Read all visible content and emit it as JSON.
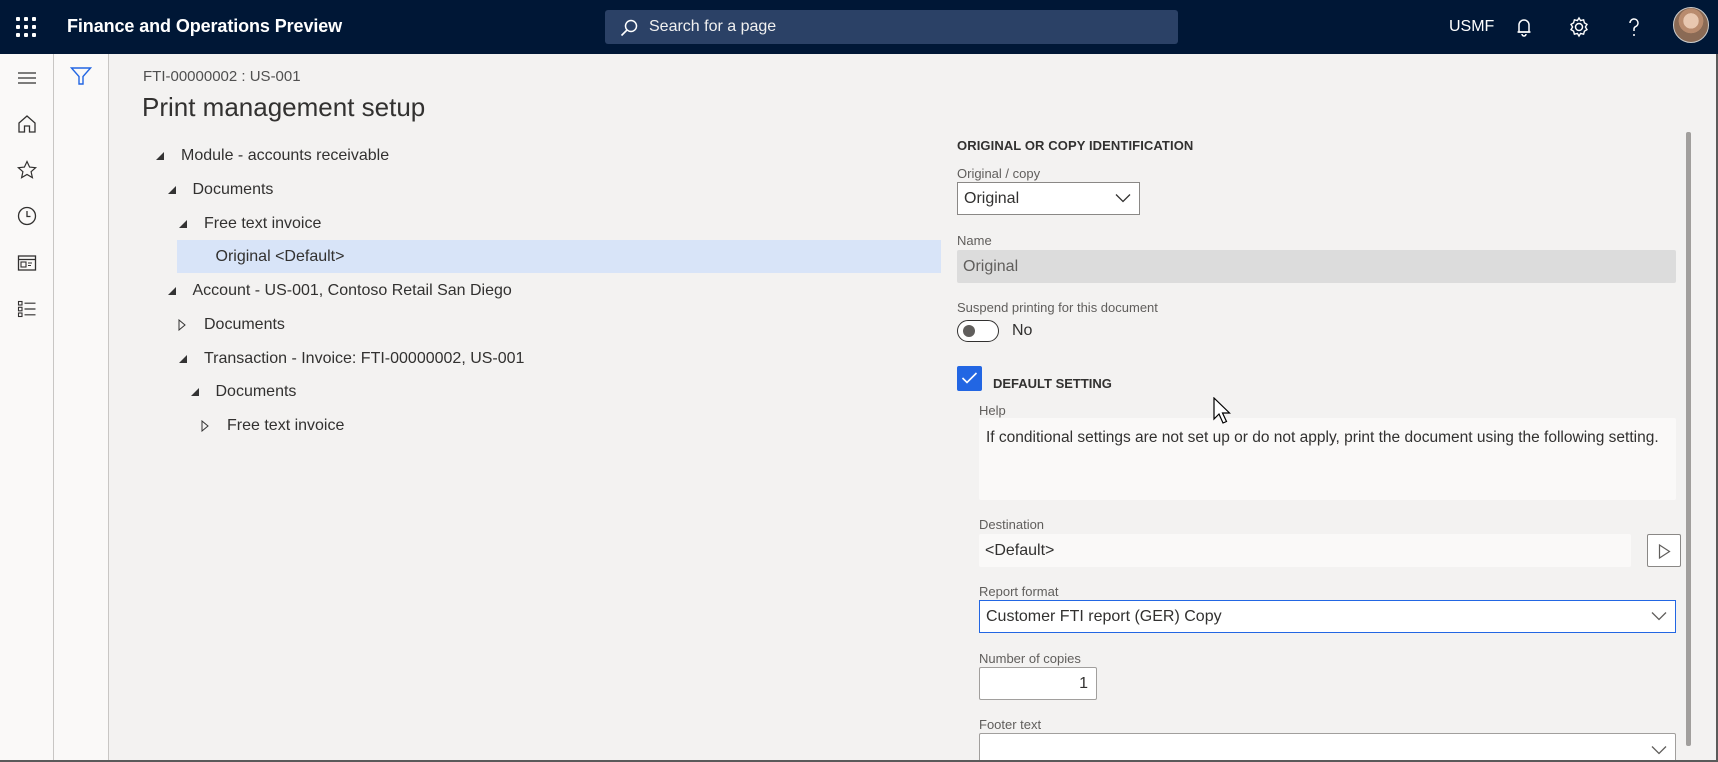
{
  "header": {
    "app_title": "Finance and Operations Preview",
    "search_placeholder": "Search for a page",
    "company": "USMF",
    "icons": [
      "app-launcher-icon",
      "search-icon",
      "bell-icon",
      "gear-icon",
      "help-icon",
      "avatar"
    ]
  },
  "navbar": {
    "items": [
      {
        "name": "hamburger-menu-icon"
      },
      {
        "name": "home-icon"
      },
      {
        "name": "favorites-star-icon"
      },
      {
        "name": "recent-clock-icon"
      },
      {
        "name": "workspaces-icon"
      },
      {
        "name": "modules-list-icon"
      }
    ]
  },
  "page": {
    "breadcrumb": "FTI-00000002 : US-001",
    "title": "Print management setup"
  },
  "tree": {
    "nodes": [
      {
        "label": "Module - accounts receivable",
        "level": 0,
        "state": "expanded",
        "selected": false
      },
      {
        "label": "Documents",
        "level": 1,
        "state": "expanded",
        "selected": false
      },
      {
        "label": "Free text invoice",
        "level": 2,
        "state": "expanded",
        "selected": false
      },
      {
        "label": "Original <Default>",
        "level": 3,
        "state": "leaf",
        "selected": true
      },
      {
        "label": "Account - US-001, Contoso Retail San Diego",
        "level": 1,
        "state": "expanded",
        "selected": false
      },
      {
        "label": "Documents",
        "level": 2,
        "state": "collapsed",
        "selected": false
      },
      {
        "label": "Transaction - Invoice: FTI-00000002, US-001",
        "level": 2,
        "state": "expanded",
        "selected": false
      },
      {
        "label": "Documents",
        "level": 3,
        "state": "expanded",
        "selected": false
      },
      {
        "label": "Free text invoice",
        "level": 4,
        "state": "collapsed",
        "selected": false
      }
    ]
  },
  "details": {
    "section_title": "ORIGINAL OR COPY IDENTIFICATION",
    "original_copy": {
      "label": "Original / copy",
      "value": "Original"
    },
    "name": {
      "label": "Name",
      "value": "Original"
    },
    "suspend": {
      "label": "Suspend printing for this document",
      "value": "No",
      "on": false
    },
    "default_setting": {
      "label": "DEFAULT SETTING",
      "checked": true
    },
    "help": {
      "label": "Help",
      "text": "If conditional settings are not set up or do not apply, print the document using the following setting."
    },
    "destination": {
      "label": "Destination",
      "value": "<Default>"
    },
    "report_format": {
      "label": "Report format",
      "value": "Customer FTI report (GER) Copy"
    },
    "copies": {
      "label": "Number of copies",
      "value": "1"
    },
    "footer": {
      "label": "Footer text",
      "value": ""
    }
  },
  "colors": {
    "header_bg": "#001736",
    "accent": "#2266e3",
    "selection": "#d8e4f8"
  }
}
